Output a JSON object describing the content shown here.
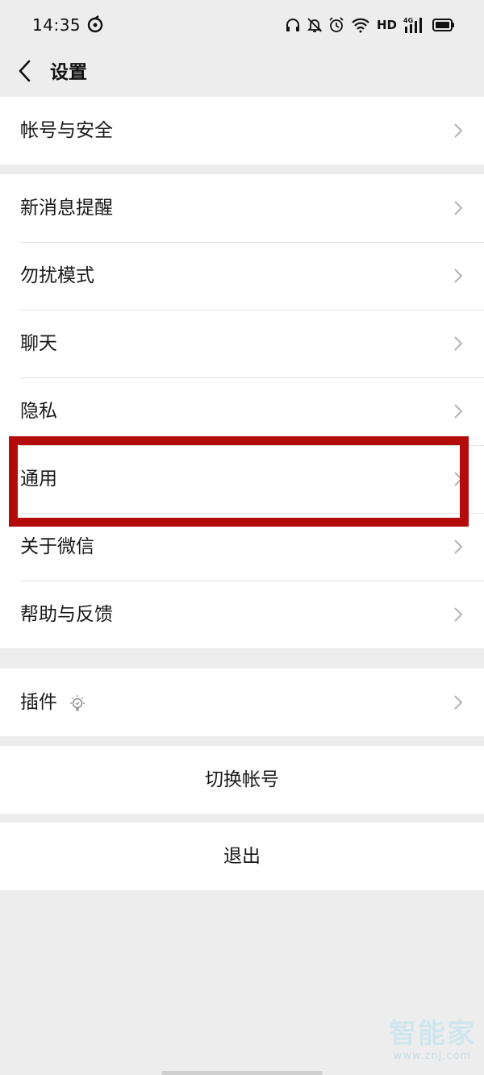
{
  "status_bar": {
    "time": "14:35",
    "hd": "HD",
    "network": "4G",
    "icons": [
      "music-icon",
      "headphones-icon",
      "bell-off-icon",
      "alarm-icon",
      "wifi-icon",
      "signal-icon",
      "battery-icon"
    ]
  },
  "nav": {
    "title": "设置",
    "back_icon": "back-arrow-icon"
  },
  "groups": {
    "account": {
      "items": [
        {
          "label": "帐号与安全"
        }
      ]
    },
    "main": {
      "items": [
        {
          "label": "新消息提醒"
        },
        {
          "label": "勿扰模式"
        },
        {
          "label": "聊天"
        },
        {
          "label": "隐私"
        },
        {
          "label": "通用",
          "highlighted": true
        },
        {
          "label": "关于微信"
        },
        {
          "label": "帮助与反馈"
        }
      ]
    },
    "plugins": {
      "items": [
        {
          "label": "插件",
          "badge_icon": "lightbulb-icon"
        }
      ]
    }
  },
  "actions": {
    "switch_account": "切换帐号",
    "logout": "退出"
  },
  "annotation": {
    "highlight_color": "#b30a0a"
  },
  "watermark": {
    "logo": "智能家",
    "url": "www.znj.com"
  },
  "colors": {
    "background": "#ededed",
    "row_background": "#ffffff",
    "text": "#191919",
    "chevron": "#b2b2b2"
  }
}
